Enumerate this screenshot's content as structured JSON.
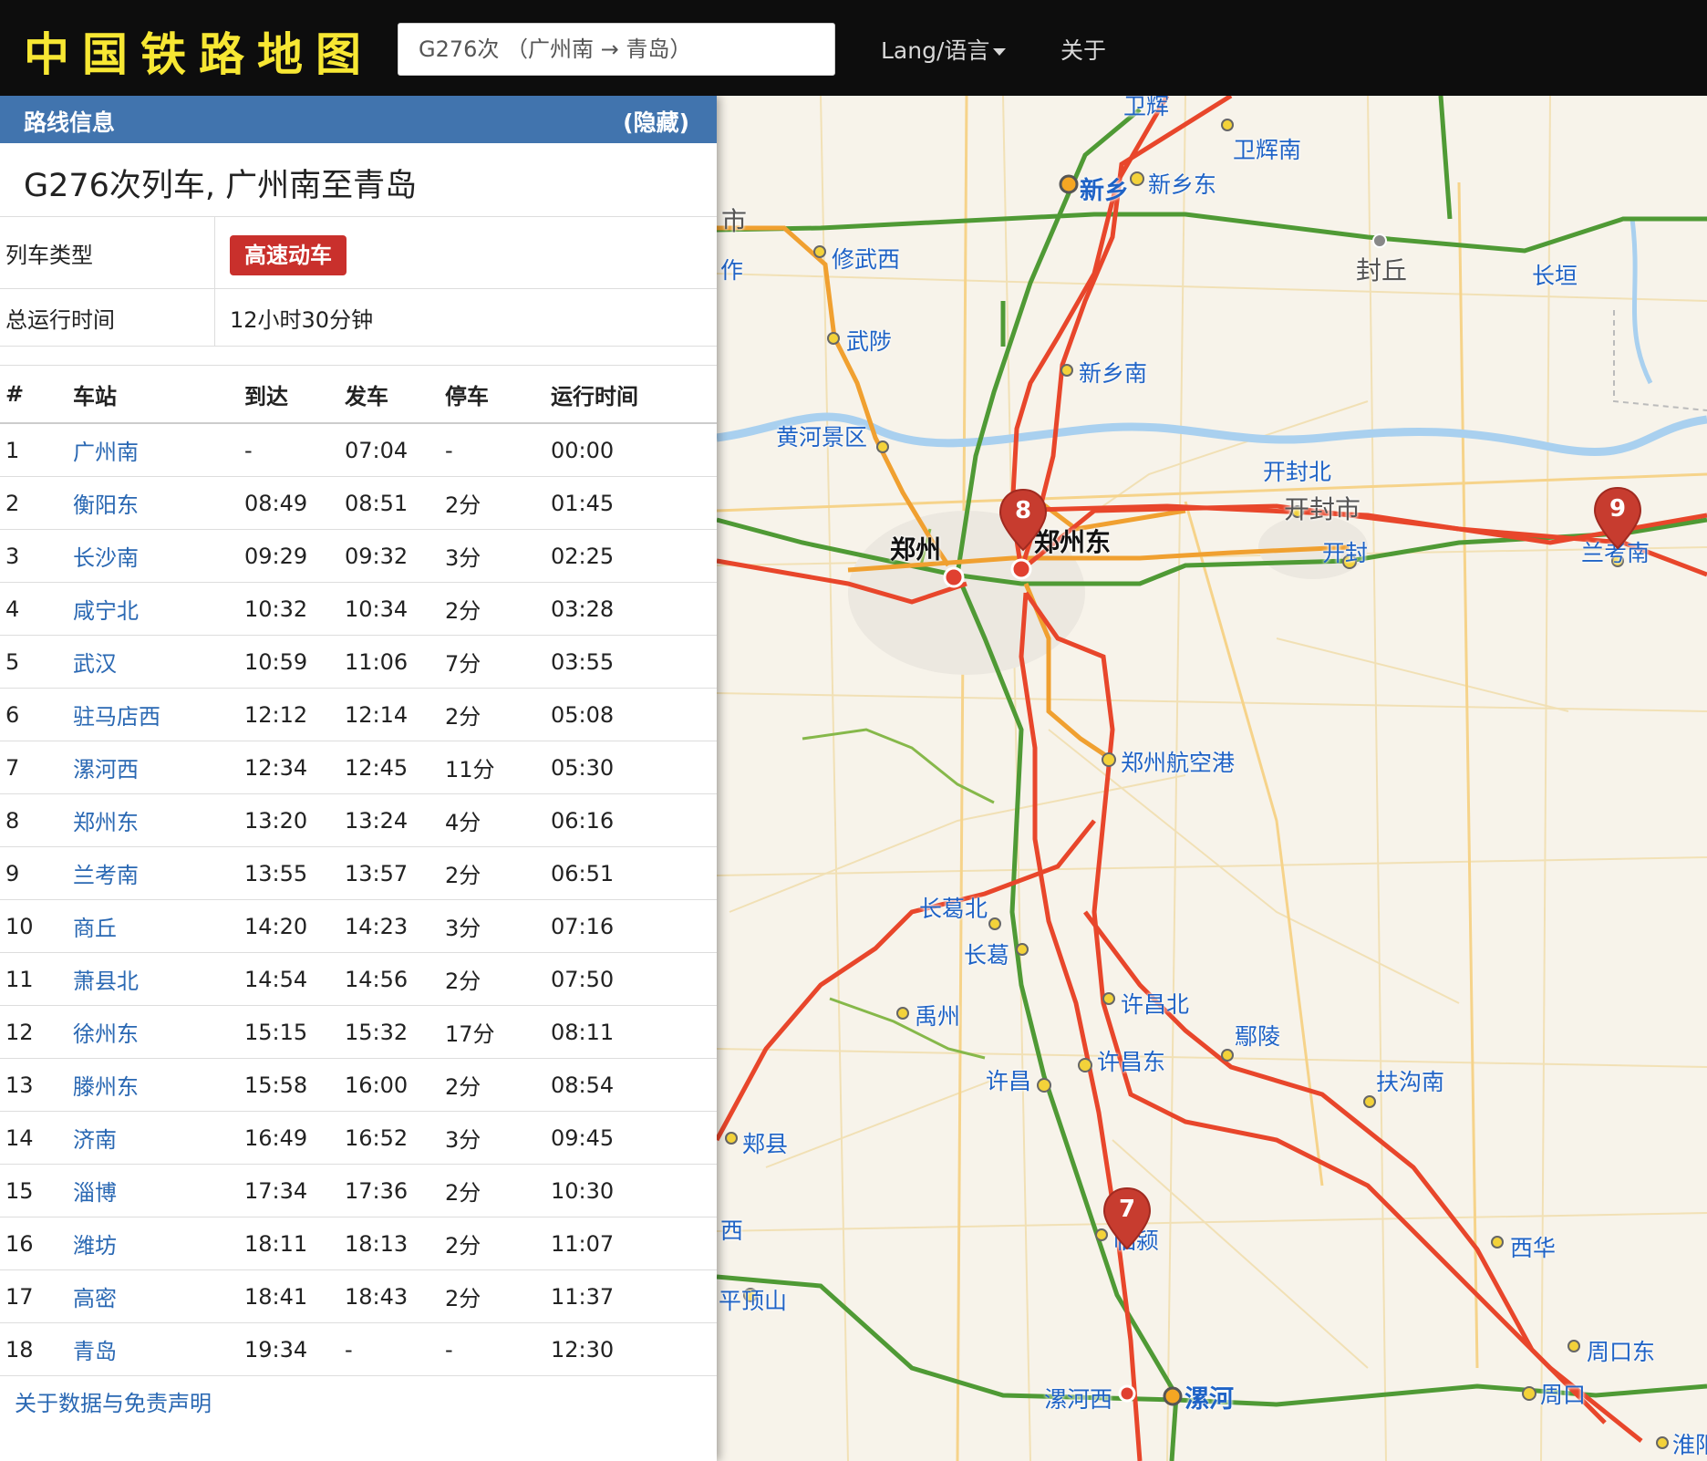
{
  "navbar": {
    "brand": "中国铁路地图",
    "search_value": "G276次 （广州南 → 青岛）",
    "lang_label": "Lang/语言",
    "about_label": "关于"
  },
  "panel": {
    "header_title": "路线信息",
    "hide_label": "(隐藏)",
    "route_title": "G276次列车, 广州南至青岛",
    "train_type_label": "列车类型",
    "train_type_value": "高速动车",
    "total_time_label": "总运行时间",
    "total_time_value": "12小时30分钟",
    "columns": [
      "#",
      "车站",
      "到达",
      "发车",
      "停车",
      "运行时间"
    ],
    "stops": [
      [
        "1",
        "广州南",
        "-",
        "07:04",
        "-",
        "00:00"
      ],
      [
        "2",
        "衡阳东",
        "08:49",
        "08:51",
        "2分",
        "01:45"
      ],
      [
        "3",
        "长沙南",
        "09:29",
        "09:32",
        "3分",
        "02:25"
      ],
      [
        "4",
        "咸宁北",
        "10:32",
        "10:34",
        "2分",
        "03:28"
      ],
      [
        "5",
        "武汉",
        "10:59",
        "11:06",
        "7分",
        "03:55"
      ],
      [
        "6",
        "驻马店西",
        "12:12",
        "12:14",
        "2分",
        "05:08"
      ],
      [
        "7",
        "漯河西",
        "12:34",
        "12:45",
        "11分",
        "05:30"
      ],
      [
        "8",
        "郑州东",
        "13:20",
        "13:24",
        "4分",
        "06:16"
      ],
      [
        "9",
        "兰考南",
        "13:55",
        "13:57",
        "2分",
        "06:51"
      ],
      [
        "10",
        "商丘",
        "14:20",
        "14:23",
        "3分",
        "07:16"
      ],
      [
        "11",
        "萧县北",
        "14:54",
        "14:56",
        "2分",
        "07:50"
      ],
      [
        "12",
        "徐州东",
        "15:15",
        "15:32",
        "17分",
        "08:11"
      ],
      [
        "13",
        "滕州东",
        "15:58",
        "16:00",
        "2分",
        "08:54"
      ],
      [
        "14",
        "济南",
        "16:49",
        "16:52",
        "3分",
        "09:45"
      ],
      [
        "15",
        "淄博",
        "17:34",
        "17:36",
        "2分",
        "10:30"
      ],
      [
        "16",
        "潍坊",
        "18:11",
        "18:13",
        "2分",
        "11:07"
      ],
      [
        "17",
        "高密",
        "18:41",
        "18:43",
        "2分",
        "11:37"
      ],
      [
        "18",
        "青岛",
        "19:34",
        "-",
        "-",
        "12:30"
      ]
    ],
    "footer_link": "关于数据与免责声明"
  },
  "map": {
    "labels": {
      "weihui": "卫辉",
      "weihuinan": "卫辉南",
      "xinxiang": "新乡",
      "xinxiangdong": "新乡东",
      "xiuwuxi": "修武西",
      "fengqiu": "封丘",
      "changyuan": "长垣",
      "wuzhi": "武陟",
      "xinxiangnan": "新乡南",
      "huanghe": "黄河景区",
      "kaifengbei": "开封北",
      "kaifengshi": "开封市",
      "zhengzhou": "郑州",
      "zhengzhoudong": "郑州东",
      "kaifeng": "开封",
      "lankaonan": "兰考南",
      "hangkonggang": "郑州航空港",
      "changgebei": "长葛北",
      "changge": "长葛",
      "yuzhou": "禹州",
      "xuchangbei": "许昌北",
      "yanling": "鄢陵",
      "xuchangdong": "许昌东",
      "xuchang": "许昌",
      "fugounan": "扶沟南",
      "jiaxian": "郏县",
      "linying": "临颍",
      "xihua": "西华",
      "pingdingshan": "平顶山",
      "zhoukoudong": "周口东",
      "luohexi": "漯河西",
      "luohe": "漯河",
      "zhoukou": "周口",
      "huaiyang": "淮阳",
      "edge_shi": "市",
      "edge_zuo": "作",
      "edge_xi": "西"
    },
    "markers": [
      "8",
      "9",
      "7"
    ],
    "colors": {
      "highspeed": "#e8462b",
      "normal": "#4f9a35",
      "orange": "#f0a030",
      "station": "#f3d23a",
      "marker": "#c73c2f"
    }
  }
}
